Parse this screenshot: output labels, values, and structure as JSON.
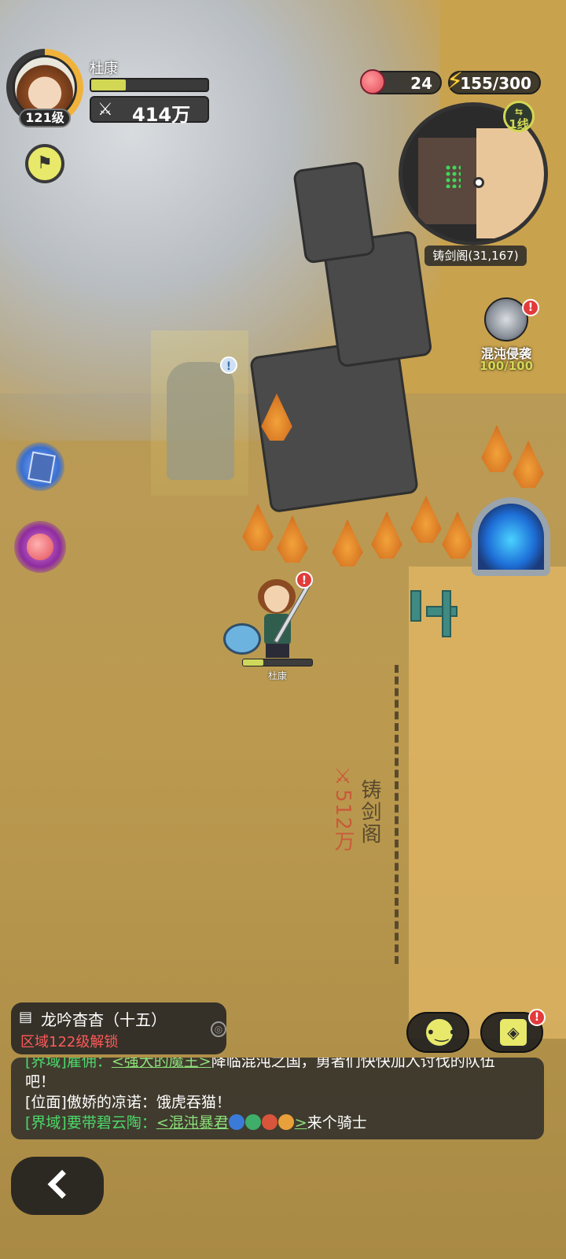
{
  "player": {
    "name": "杜康",
    "level": "121级",
    "power": "414万",
    "exp_progress": 0.3,
    "hp_progress": 0.3
  },
  "resources": {
    "peach": "24",
    "energy": "155/300"
  },
  "minimap": {
    "line_label": "1线",
    "location": "铸剑阁(31,167)"
  },
  "event": {
    "name": "混沌侵袭",
    "count": "100/100"
  },
  "map": {
    "region_name": "铸剑阁",
    "region_power": "512万"
  },
  "quest": {
    "title": "龙吟杳杳（十五）",
    "subtitle": "区域122级解锁"
  },
  "chat": {
    "line1_channel": "[界域]",
    "line1_sender": "雇佣：",
    "line1_link": "<强大的魔王>",
    "line1_text": "降临混沌之国，勇者们快快加入讨伐的队伍",
    "line1_cont": "吧！",
    "line2_channel": "[位面]",
    "line2_sender": "傲娇的凉诺：",
    "line2_text": "饿虎吞猫！",
    "line3_channel": "[界域]",
    "line3_sender": "要带碧云陶：",
    "line3_link": "<混沌暴君",
    "line3_link_end": ">",
    "line3_text": "来个骑士"
  },
  "colors": {
    "accent_yellow": "#d2d754",
    "alert_red": "#e23b3b",
    "realm_channel": "#4bd86a",
    "quest_locked": "#ff5a5a"
  },
  "icons": {
    "power": "crossed-swords-icon",
    "energy": "lightning-icon",
    "peach": "peach-icon",
    "flag": "flag-icon",
    "emoji": "smile-face-icon",
    "box": "box-icon",
    "back": "chevron-left-icon"
  }
}
